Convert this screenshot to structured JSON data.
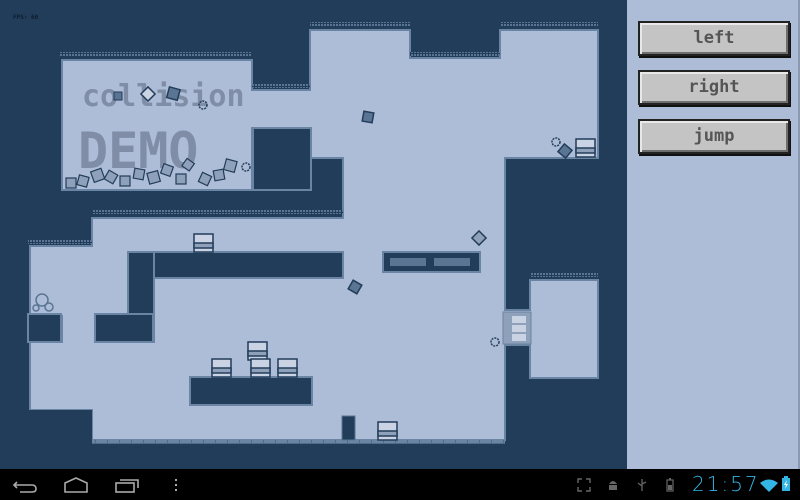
{
  "game": {
    "fps_label": "FPS: 60",
    "title_line1": "collision",
    "title_line2": "DEMO",
    "palette": {
      "wall": "#223d5a",
      "space": "#adbcd7",
      "edge": "#5a7593",
      "title_text": "#7f8da6",
      "crate_top": "#c9d3e4",
      "crate_mid": "#8fa0ba"
    }
  },
  "controls": {
    "buttons": [
      {
        "label": "left"
      },
      {
        "label": "right"
      },
      {
        "label": "jump"
      }
    ]
  },
  "navbar": {
    "back_icon": "back-icon",
    "home_icon": "home-icon",
    "recents_icon": "recent-apps-icon",
    "menu_icon": "overflow-menu-icon"
  },
  "status": {
    "time": "21:57",
    "icons": [
      "fullscreen-icon",
      "android-debug-icon",
      "usb-icon",
      "battery-small-icon",
      "wifi-icon",
      "battery-icon"
    ],
    "accent": "#33b5e5"
  }
}
